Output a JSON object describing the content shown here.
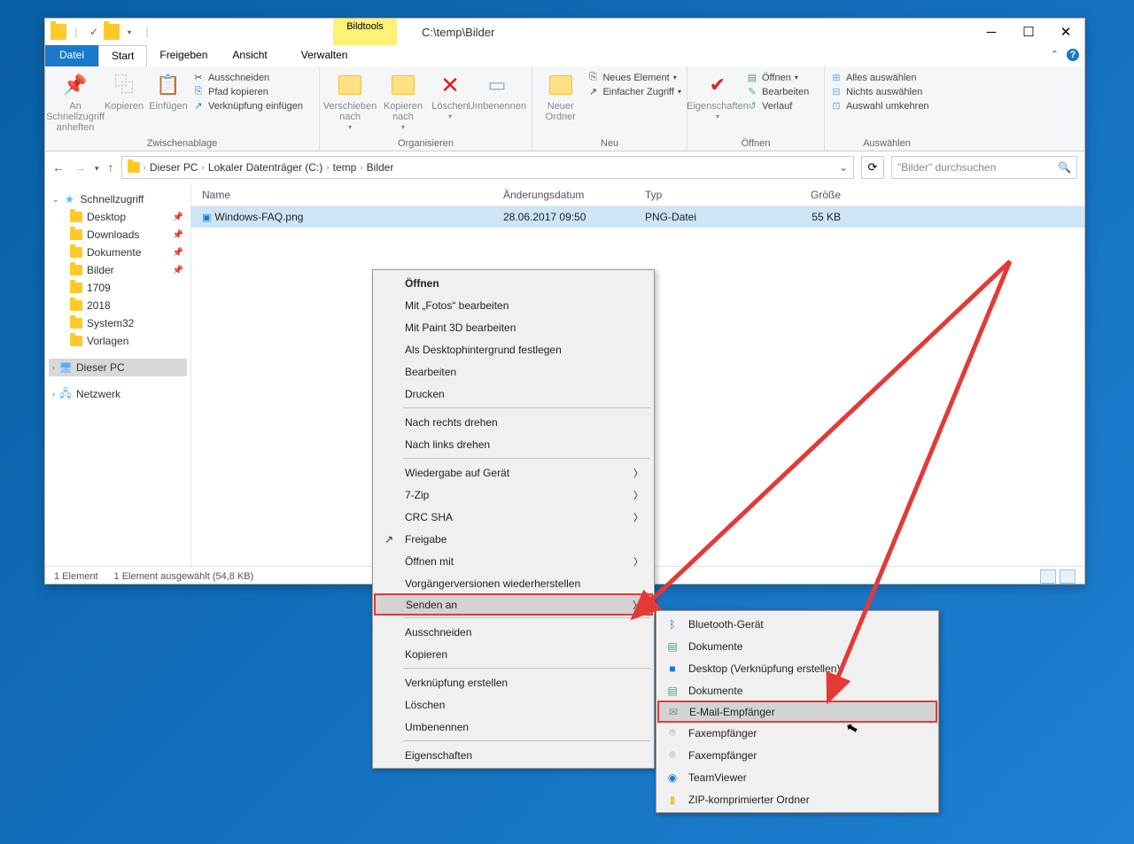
{
  "title": "C:\\temp\\Bilder",
  "tools_header": "Bildtools",
  "tools_tab": "Verwalten",
  "tabs": {
    "file": "Datei",
    "start": "Start",
    "share": "Freigeben",
    "view": "Ansicht"
  },
  "ribbon": {
    "g1": {
      "label": "Zwischenablage",
      "pin": "An Schnellzugriff anheften",
      "copy": "Kopieren",
      "paste": "Einfügen",
      "cut": "Ausschneiden",
      "copypath": "Pfad kopieren",
      "pastelink": "Verknüpfung einfügen"
    },
    "g2": {
      "label": "Organisieren",
      "move": "Verschieben nach",
      "copyto": "Kopieren nach",
      "del": "Löschen",
      "ren": "Umbenennen"
    },
    "g3": {
      "label": "Neu",
      "newfolder": "Neuer Ordner",
      "newitem": "Neues Element",
      "easy": "Einfacher Zugriff"
    },
    "g4": {
      "label": "Öffnen",
      "prop": "Eigenschaften",
      "open": "Öffnen",
      "edit": "Bearbeiten",
      "hist": "Verlauf"
    },
    "g5": {
      "label": "Auswählen",
      "all": "Alles auswählen",
      "none": "Nichts auswählen",
      "inv": "Auswahl umkehren"
    }
  },
  "breadcrumb": [
    "Dieser PC",
    "Lokaler Datenträger (C:)",
    "temp",
    "Bilder"
  ],
  "search_placeholder": "\"Bilder\" durchsuchen",
  "columns": {
    "name": "Name",
    "date": "Änderungsdatum",
    "type": "Typ",
    "size": "Größe"
  },
  "file": {
    "name": "Windows-FAQ.png",
    "date": "28.06.2017 09:50",
    "type": "PNG-Datei",
    "size": "55 KB"
  },
  "tree": {
    "quickaccess": "Schnellzugriff",
    "items": [
      {
        "label": "Desktop",
        "pin": true
      },
      {
        "label": "Downloads",
        "pin": true
      },
      {
        "label": "Dokumente",
        "pin": true
      },
      {
        "label": "Bilder",
        "pin": true
      },
      {
        "label": "1709"
      },
      {
        "label": "2018"
      },
      {
        "label": "System32"
      },
      {
        "label": "Vorlagen"
      }
    ],
    "thispc": "Dieser PC",
    "network": "Netzwerk"
  },
  "status": {
    "count": "1 Element",
    "sel": "1 Element ausgewählt (54,8 KB)"
  },
  "ctx1": [
    {
      "t": "Öffnen",
      "bold": true
    },
    {
      "t": "Mit „Fotos“ bearbeiten"
    },
    {
      "t": "Mit Paint 3D bearbeiten"
    },
    {
      "t": "Als Desktophintergrund festlegen"
    },
    {
      "t": "Bearbeiten"
    },
    {
      "t": "Drucken"
    },
    {
      "sep": true
    },
    {
      "t": "Nach rechts drehen"
    },
    {
      "t": "Nach links drehen"
    },
    {
      "sep": true
    },
    {
      "t": "Wiedergabe auf Gerät",
      "sub": true
    },
    {
      "t": "7-Zip",
      "sub": true
    },
    {
      "t": "CRC SHA",
      "sub": true
    },
    {
      "t": "Freigabe",
      "ico": "↗"
    },
    {
      "t": "Öffnen mit",
      "sub": true
    },
    {
      "t": "Vorgängerversionen wiederherstellen"
    },
    {
      "t": "Senden an",
      "sub": true,
      "hl": true
    },
    {
      "sep": true
    },
    {
      "t": "Ausschneiden"
    },
    {
      "t": "Kopieren"
    },
    {
      "sep": true
    },
    {
      "t": "Verknüpfung erstellen"
    },
    {
      "t": "Löschen"
    },
    {
      "t": "Umbenennen"
    },
    {
      "sep": true
    },
    {
      "t": "Eigenschaften"
    }
  ],
  "ctx2": [
    {
      "t": "Bluetooth-Gerät",
      "ico": "ᛒ",
      "c": "#1979ca"
    },
    {
      "t": "Dokumente",
      "ico": "▤",
      "c": "#4a7"
    },
    {
      "t": "Desktop (Verknüpfung erstellen)",
      "ico": "■",
      "c": "#1979ca"
    },
    {
      "t": "Dokumente",
      "ico": "▤",
      "c": "#4a7"
    },
    {
      "t": "E-Mail-Empfänger",
      "ico": "✉",
      "c": "#888",
      "hl": true
    },
    {
      "t": "Faxempfänger",
      "ico": "⌾",
      "c": "#888"
    },
    {
      "t": "Faxempfänger",
      "ico": "⌾",
      "c": "#888"
    },
    {
      "t": "TeamViewer",
      "ico": "◉",
      "c": "#1979ca"
    },
    {
      "t": "ZIP-komprimierter Ordner",
      "ico": "▮",
      "c": "#f0c040"
    }
  ]
}
